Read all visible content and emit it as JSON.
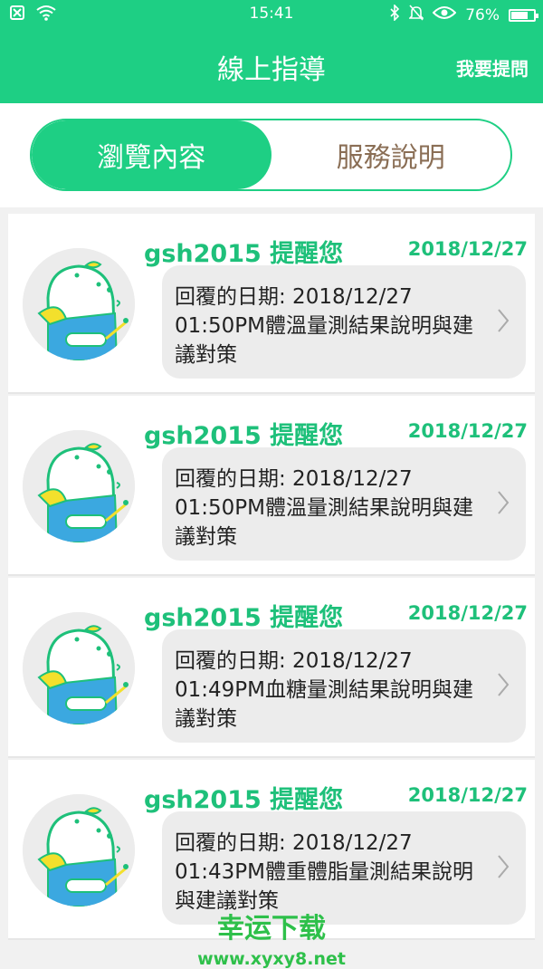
{
  "status_bar": {
    "time": "15:41",
    "battery": "76%",
    "battery_level": 0.76,
    "icons": [
      "notification-icon",
      "wifi-icon",
      "bluetooth-icon",
      "mute-icon",
      "eye-icon",
      "battery-icon"
    ]
  },
  "header": {
    "title": "線上指導",
    "action_label": "我要提問"
  },
  "tabs": [
    {
      "label": "瀏覽內容",
      "active": true
    },
    {
      "label": "服務說明",
      "active": false
    }
  ],
  "messages": [
    {
      "sender": "gsh2015 提醒您",
      "date": "2018/12/27",
      "text": "回覆的日期: 2018/12/27 01:50PM體溫量測結果說明與建議對策"
    },
    {
      "sender": "gsh2015 提醒您",
      "date": "2018/12/27",
      "text": "回覆的日期: 2018/12/27 01:50PM體溫量測結果說明與建議對策"
    },
    {
      "sender": "gsh2015 提醒您",
      "date": "2018/12/27",
      "text": "回覆的日期: 2018/12/27 01:49PM血糖量測結果說明與建議對策"
    },
    {
      "sender": "gsh2015 提醒您",
      "date": "2018/12/27",
      "text": "回覆的日期: 2018/12/27 01:43PM體重體脂量測結果說明與建議對策"
    }
  ],
  "watermark": {
    "text": "幸运下载",
    "url": "www.xyxy8.net"
  },
  "colors": {
    "brand": "#1ecf84",
    "sender_text": "#1ec07a",
    "bubble": "#ececec",
    "inactive_tab_text": "#8a6e55"
  }
}
